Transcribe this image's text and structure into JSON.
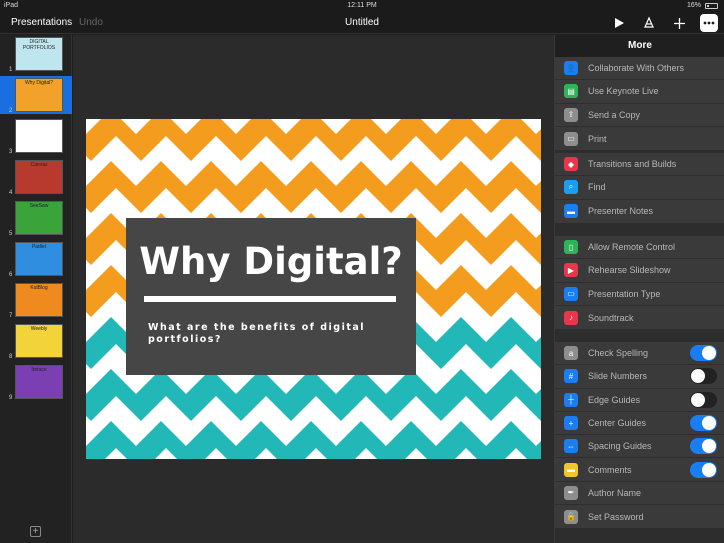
{
  "status": {
    "device": "iPad",
    "time": "12:11 PM",
    "battery": "16%"
  },
  "toolbar": {
    "back_label": "Presentations",
    "undo_label": "Undo",
    "title": "Untitled"
  },
  "navigator": {
    "slides": [
      {
        "number": "1",
        "label": "DIGITAL PORTFOLIOS",
        "bg": "#bfe6ef",
        "selected": false
      },
      {
        "number": "2",
        "label": "Why Digital?",
        "bg": "#f2a12b",
        "selected": true
      },
      {
        "number": "3",
        "label": "",
        "bg": "#ffffff",
        "selected": false
      },
      {
        "number": "4",
        "label": "Canvas",
        "bg": "#b83a2e",
        "selected": false
      },
      {
        "number": "5",
        "label": "SeeSaw",
        "bg": "#3aa43b",
        "selected": false
      },
      {
        "number": "6",
        "label": "Padlet",
        "bg": "#2f8ee0",
        "selected": false
      },
      {
        "number": "7",
        "label": "KidBlog",
        "bg": "#ef8a1f",
        "selected": false
      },
      {
        "number": "8",
        "label": "Weebly",
        "bg": "#f2d33a",
        "selected": false
      },
      {
        "number": "9",
        "label": "Ibtrace",
        "bg": "#7b3fb3",
        "selected": false
      }
    ]
  },
  "slide": {
    "title": "Why Digital?",
    "subtitle": "What are the benefits of digital portfolios?",
    "colors": {
      "orange": "#f39c1e",
      "teal": "#22b8b8",
      "box": "#464646"
    }
  },
  "panel": {
    "title": "More",
    "groups": [
      [
        {
          "label": "Collaborate With Others",
          "icon": "person-icon",
          "color": "#1a7ef2"
        },
        {
          "label": "Use Keynote Live",
          "icon": "keynote-live-icon",
          "color": "#2fb35a"
        },
        {
          "label": "Send a Copy",
          "icon": "share-icon",
          "color": "#8e8e8e"
        },
        {
          "label": "Print",
          "icon": "print-icon",
          "color": "#8e8e8e"
        }
      ],
      [
        {
          "label": "Transitions and Builds",
          "icon": "diamond-icon",
          "color": "#e8364a"
        },
        {
          "label": "Find",
          "icon": "search-icon",
          "color": "#1a9ef2"
        },
        {
          "label": "Presenter Notes",
          "icon": "notes-icon",
          "color": "#1a7ef2"
        }
      ],
      [
        {
          "label": "Allow Remote Control",
          "icon": "remote-icon",
          "color": "#2fb35a"
        },
        {
          "label": "Rehearse Slideshow",
          "icon": "play-icon",
          "color": "#e8364a"
        },
        {
          "label": "Presentation Type",
          "icon": "screen-icon",
          "color": "#1a7ef2"
        },
        {
          "label": "Soundtrack",
          "icon": "music-icon",
          "color": "#e8364a"
        }
      ],
      [
        {
          "label": "Check Spelling",
          "icon": "spelling-icon",
          "color": "#8e8e8e",
          "toggle": true
        },
        {
          "label": "Slide Numbers",
          "icon": "hash-icon",
          "color": "#1a7ef2",
          "toggle": false
        },
        {
          "label": "Edge Guides",
          "icon": "edge-guides-icon",
          "color": "#1a7ef2",
          "toggle": false
        },
        {
          "label": "Center Guides",
          "icon": "center-guides-icon",
          "color": "#1a7ef2",
          "toggle": true
        },
        {
          "label": "Spacing Guides",
          "icon": "spacing-guides-icon",
          "color": "#1a7ef2",
          "toggle": true
        },
        {
          "label": "Comments",
          "icon": "comment-icon",
          "color": "#f2c52a",
          "toggle": true
        },
        {
          "label": "Author Name",
          "icon": "pen-icon",
          "color": "#8e8e8e"
        },
        {
          "label": "Set Password",
          "icon": "lock-icon",
          "color": "#8e8e8e"
        }
      ]
    ]
  }
}
